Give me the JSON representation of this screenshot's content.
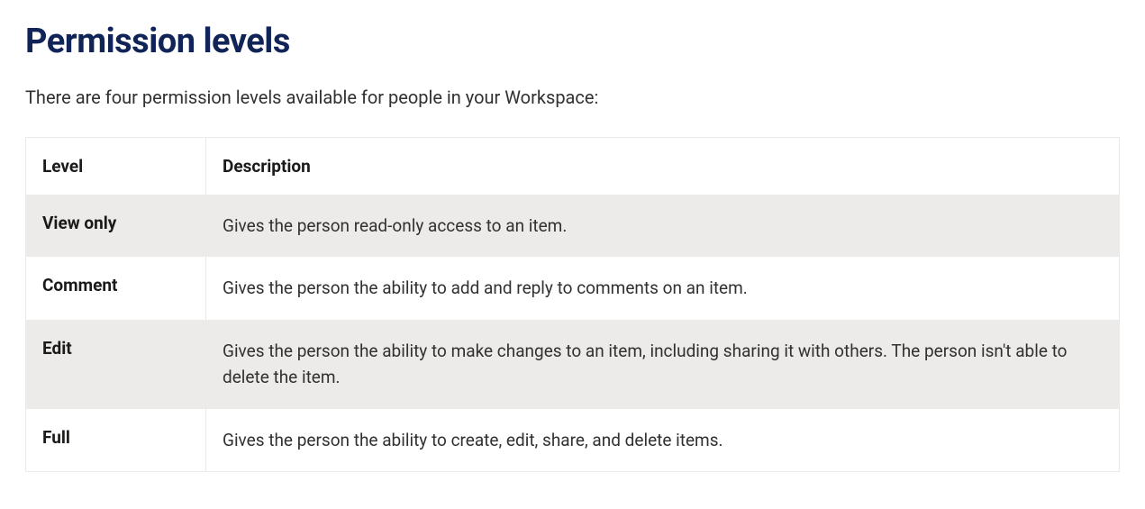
{
  "heading": "Permission levels",
  "intro": "There are four permission levels available for people in your Workspace:",
  "table": {
    "headers": {
      "level": "Level",
      "description": "Description"
    },
    "rows": [
      {
        "level": "View only",
        "description": "Gives the person read-only access to an item."
      },
      {
        "level": "Comment",
        "description": "Gives the person the ability to add and reply to comments on an item."
      },
      {
        "level": "Edit",
        "description": "Gives the person the ability to make changes to an item, including sharing it with others. The person isn't able to delete the item."
      },
      {
        "level": "Full",
        "description": "Gives the person the ability to create, edit, share, and delete items."
      }
    ]
  }
}
